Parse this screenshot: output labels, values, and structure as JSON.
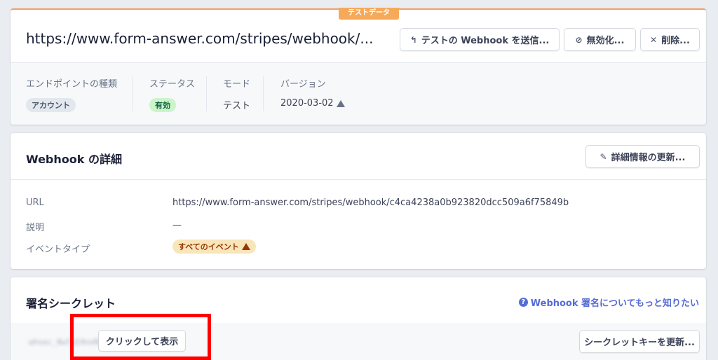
{
  "header": {
    "badge": "テストデータ",
    "url": "https://www.form-answer.com/stripes/webhook/...",
    "buttons": {
      "send_test": "テストの Webhook を送信...",
      "disable": "無効化...",
      "delete": "削除..."
    },
    "icons": {
      "send_test": "return-arrow-icon",
      "disable": "ban-icon",
      "delete": "close-icon"
    }
  },
  "meta": {
    "endpoint_type_label": "エンドポイントの種類",
    "endpoint_type_value": "アカウント",
    "status_label": "ステータス",
    "status_value": "有効",
    "mode_label": "モード",
    "mode_value": "テスト",
    "version_label": "バージョン",
    "version_value": "2020-03-02"
  },
  "details": {
    "title": "Webhook の詳細",
    "update_button": "詳細情報の更新...",
    "url_label": "URL",
    "url_value": "https://www.form-answer.com/stripes/webhook/c4ca4238a0b923820dcc509a6f75849b",
    "description_label": "説明",
    "description_value": "—",
    "event_type_label": "イベントタイプ",
    "event_type_value": "すべてのイベント"
  },
  "secret": {
    "title": "署名シークレット",
    "help_link": "Webhook 署名についてもっと知りたい",
    "masked_value": "whsec_8wfpI4nxRpVxd1GBaJ8H4Hs",
    "reveal_button": "クリックして表示",
    "roll_button": "シークレットキーを更新..."
  },
  "colors": {
    "accent": "#556cd6",
    "test_badge": "#f7a95a",
    "status_green": "#cbf4c9",
    "warning_orange": "#f8e5b9",
    "highlight_red": "#ff0000"
  }
}
